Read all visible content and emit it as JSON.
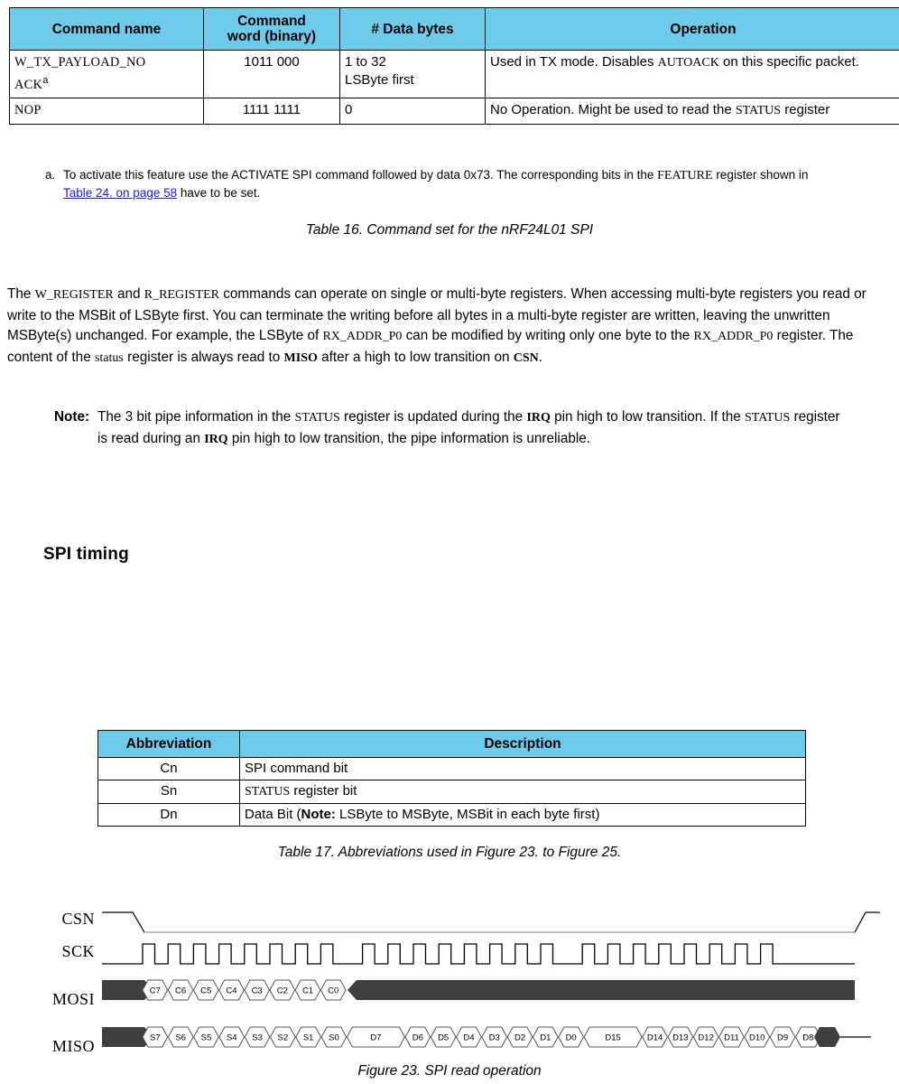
{
  "table16": {
    "headers": [
      "Command name",
      "Command word (binary)",
      "# Data bytes",
      "Operation"
    ],
    "headers_split": {
      "h1": "Command name",
      "h2_line1": "Command",
      "h2_line2": "word (binary)",
      "h3": "# Data bytes",
      "h4": "Operation"
    },
    "rows": [
      {
        "name_line1": "W_TX_PAYLOAD_NO",
        "name_line2": "ACK",
        "name_superscript": "a",
        "word": "1011 000",
        "bytes_line1": "1 to 32",
        "bytes_line2": "LSByte first",
        "op_pre": "Used in TX mode. Disables ",
        "op_mono": "AUTOACK",
        "op_post": " on this specific packet."
      },
      {
        "name_line1": "NOP",
        "name_line2": "",
        "name_superscript": "",
        "word": "1111 1111",
        "bytes_line1": "0",
        "bytes_line2": "",
        "op_pre": "No Operation. Might be used to read the ",
        "op_mono": "STATUS",
        "op_post": " register"
      }
    ]
  },
  "footnote": {
    "marker": "a.",
    "part1": "To activate this feature use the ACTIVATE SPI command followed by data 0x73. The corresponding bits in the ",
    "mono1": "FEATURE",
    "part2": " register shown in ",
    "link": "Table 24. on page 58",
    "part3": " have to be set."
  },
  "captions": {
    "table16": "Table 16. Command set for the nRF24L01 SPI",
    "table17": "Table 17. Abbreviations used in Figure 23. to Figure 25.",
    "figure23": "Figure 23. SPI read operation"
  },
  "body_paragraph": {
    "s1": "The ",
    "m1": "W_REGISTER",
    "s2": " and ",
    "m2": "R_REGISTER",
    "s3": " commands can operate on single or multi-byte registers. When accessing multi-byte registers you read or write to the MSBit of LSByte first. You can terminate the writing before all bytes in a multi-byte register are written, leaving the unwritten MSByte(s) unchanged. For example, the LSByte of ",
    "m3": "RX_ADDR_P0",
    "s4": " can be modified by writing only one byte to the ",
    "m4": "RX_ADDR_P0",
    "s5": " register. The content of the ",
    "m5": "status",
    "s6": " register is always read to ",
    "m6": "MISO",
    "s7": " after a high to low transition on ",
    "m7": "CSN",
    "s8": "."
  },
  "note": {
    "label": "Note:",
    "s1": "The 3 bit pipe information in the ",
    "m1": "STATUS",
    "s2": " register is updated during the ",
    "m2": "IRQ",
    "s3": " pin high to low transition. If the ",
    "m3": "STATUS",
    "s4": " register is read during an ",
    "m4": "IRQ",
    "s5": " pin high to low transition, the pipe information is unreliable."
  },
  "section_heading": "SPI timing",
  "table17": {
    "headers": [
      "Abbreviation",
      "Description"
    ],
    "rows": [
      {
        "abbr": "Cn",
        "desc_pre": "SPI command bit",
        "desc_mono": "",
        "desc_post": "",
        "bold_note": ""
      },
      {
        "abbr": "Sn",
        "desc_pre": "",
        "desc_mono": "STATUS",
        "desc_post": " register bit",
        "bold_note": ""
      },
      {
        "abbr": "Dn",
        "desc_pre": "Data Bit (",
        "desc_mono": "",
        "bold_note": "Note:",
        "desc_post": " LSByte to MSByte, MSBit in each byte first)"
      }
    ]
  },
  "timing_diagram": {
    "signals": [
      "CSN",
      "SCK",
      "MOSI",
      "MISO"
    ],
    "csn": {
      "initial": "high",
      "falls_early": true,
      "rises_at_end": true
    },
    "sck": {
      "total_pulses": 24,
      "groups": 3,
      "pulses_per_group": 8
    },
    "mosi_cells": [
      "C7",
      "C6",
      "C5",
      "C4",
      "C3",
      "C2",
      "C1",
      "C0"
    ],
    "miso_cells": [
      "S7",
      "S6",
      "S5",
      "S4",
      "S3",
      "S2",
      "S1",
      "S0",
      "D7",
      "D6",
      "D5",
      "D4",
      "D3",
      "D2",
      "D1",
      "D0",
      "D15",
      "D14",
      "D13",
      "D12",
      "D11",
      "D10",
      "D9",
      "D8"
    ],
    "colors": {
      "dont_care_fill": "#3f3f3f",
      "cell_stroke": "#555555",
      "line": "#000000",
      "csn_low_line": "#bbbbbb"
    }
  },
  "colors": {
    "table_header_blue": "#6FCBEA",
    "link_blue": "#1a1aee",
    "border": "#000000",
    "text": "#000000"
  }
}
